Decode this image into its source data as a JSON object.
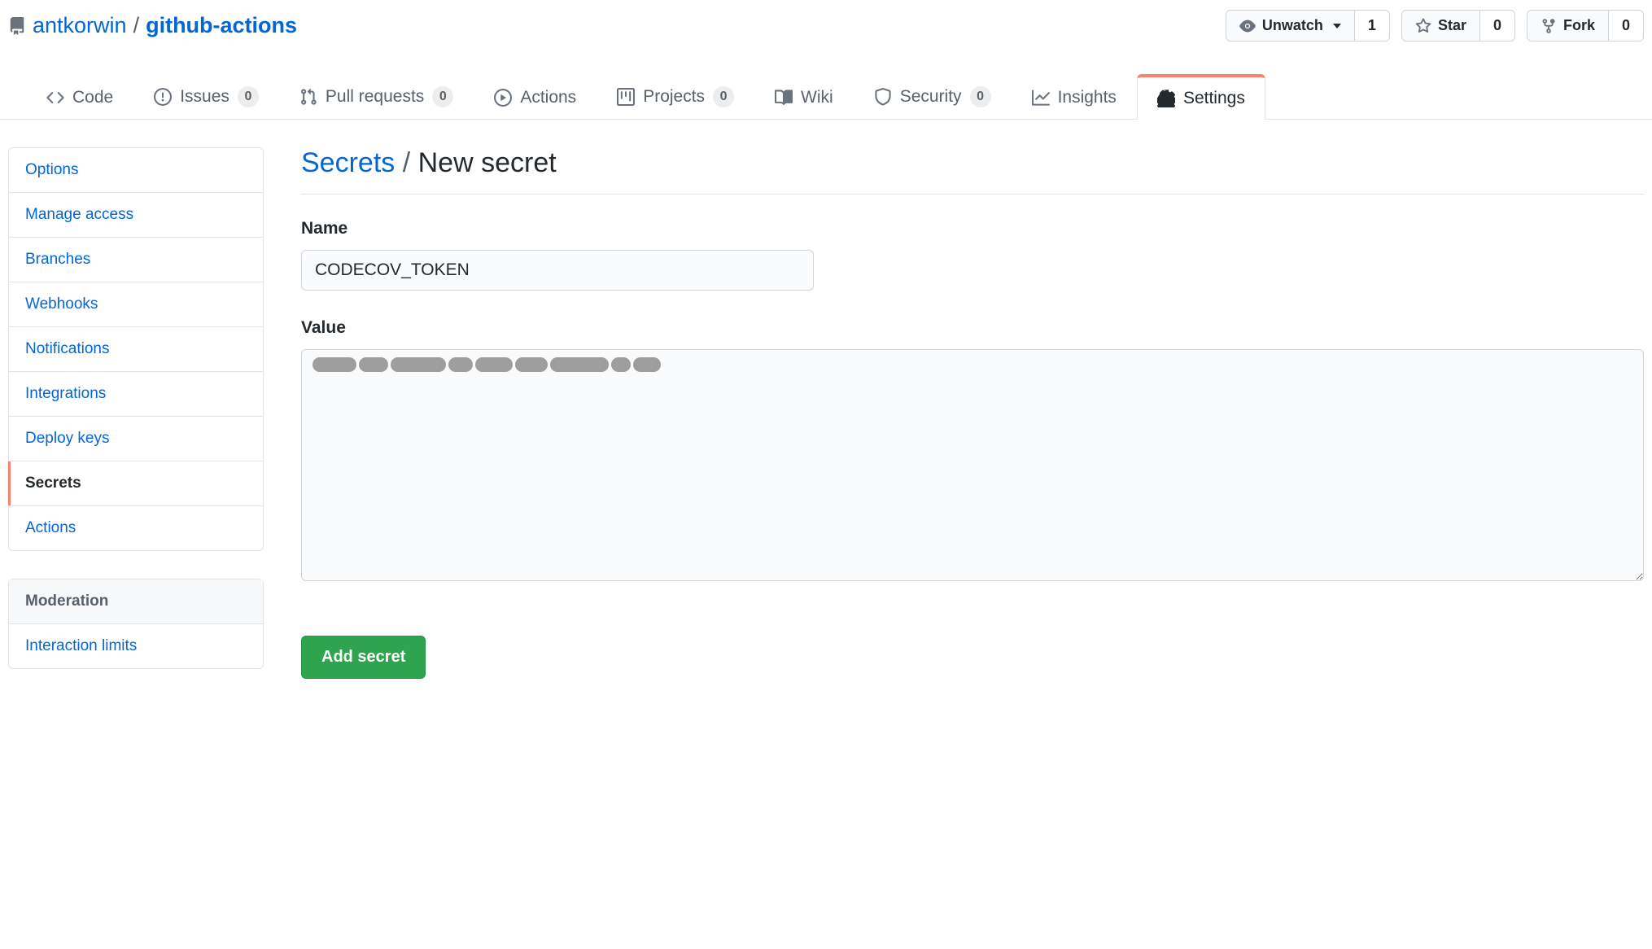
{
  "header": {
    "owner": "antkorwin",
    "separator": "/",
    "repo": "github-actions"
  },
  "repo_actions": {
    "watch": {
      "label": "Unwatch",
      "count": "1"
    },
    "star": {
      "label": "Star",
      "count": "0"
    },
    "fork": {
      "label": "Fork",
      "count": "0"
    }
  },
  "tabs": {
    "code": {
      "label": "Code"
    },
    "issues": {
      "label": "Issues",
      "count": "0"
    },
    "pull_requests": {
      "label": "Pull requests",
      "count": "0"
    },
    "actions": {
      "label": "Actions"
    },
    "projects": {
      "label": "Projects",
      "count": "0"
    },
    "wiki": {
      "label": "Wiki"
    },
    "security": {
      "label": "Security",
      "count": "0"
    },
    "insights": {
      "label": "Insights"
    },
    "settings": {
      "label": "Settings"
    }
  },
  "sidebar": {
    "items": {
      "options": "Options",
      "manage_access": "Manage access",
      "branches": "Branches",
      "webhooks": "Webhooks",
      "notifications": "Notifications",
      "integrations": "Integrations",
      "deploy_keys": "Deploy keys",
      "secrets": "Secrets",
      "actions": "Actions"
    },
    "moderation_heading": "Moderation",
    "moderation_items": {
      "interaction_limits": "Interaction limits"
    }
  },
  "page": {
    "breadcrumb_link": "Secrets",
    "breadcrumb_sep": "/",
    "breadcrumb_current": "New secret",
    "name_label": "Name",
    "name_value": "CODECOV_TOKEN",
    "value_label": "Value",
    "submit_label": "Add secret"
  }
}
